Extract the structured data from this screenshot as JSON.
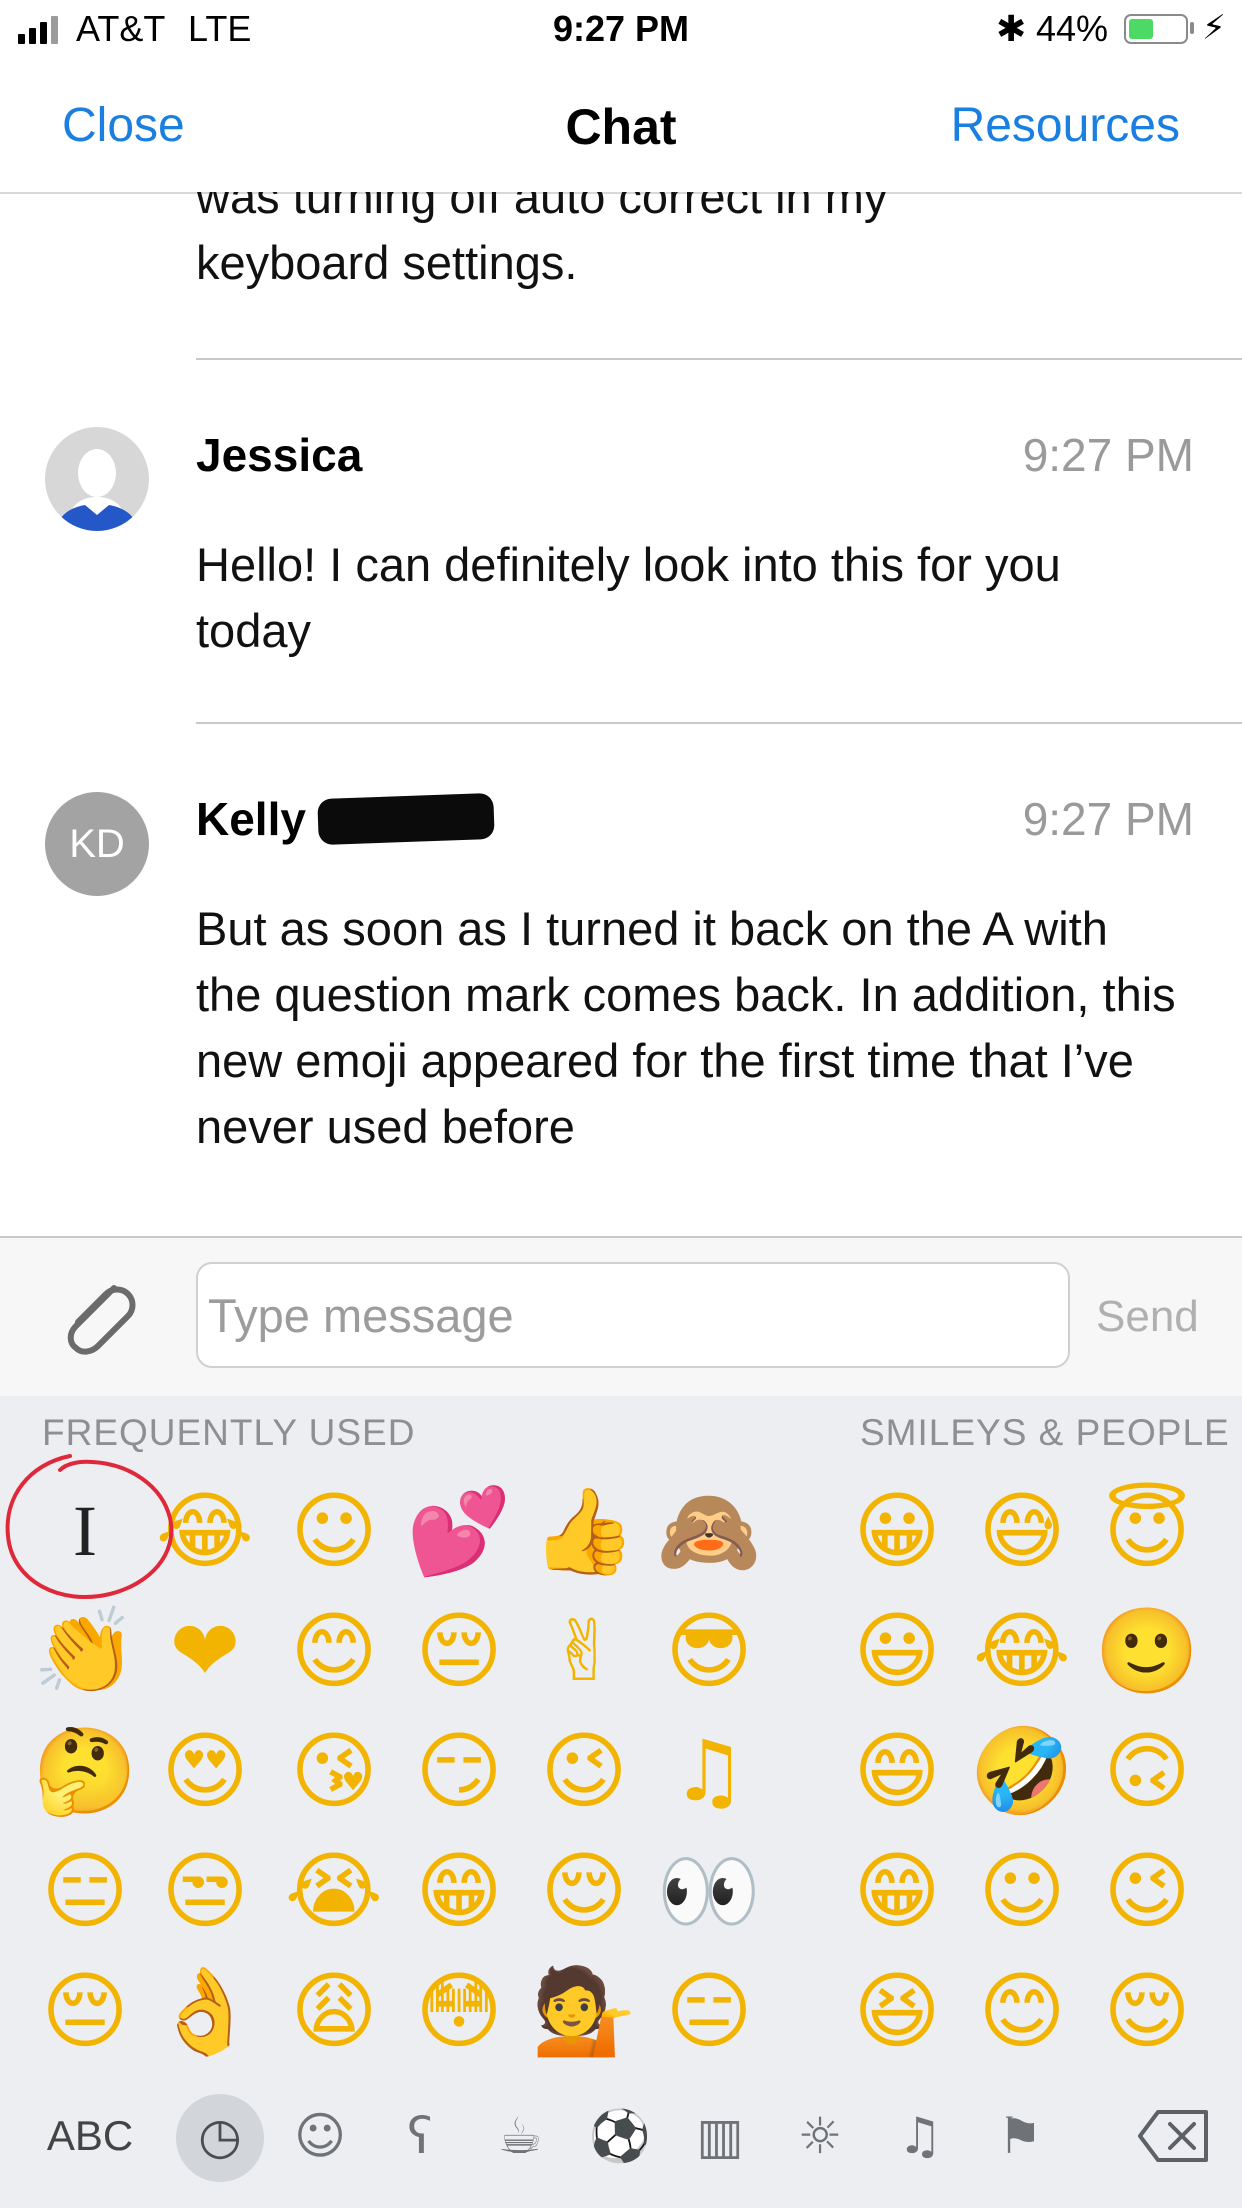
{
  "status_bar": {
    "carrier": "AT&T",
    "network": "LTE",
    "time": "9:27 PM",
    "battery": "44%",
    "battery_level": 0.44
  },
  "nav": {
    "close": "Close",
    "title": "Chat",
    "resources": "Resources"
  },
  "messages": [
    {
      "text_line1": "was turning off auto correct in my",
      "text_line2": "keyboard settings."
    },
    {
      "sender": "Jessica",
      "time": "9:27 PM",
      "text": "Hello! I can definitely look into this for you today"
    },
    {
      "sender": "Kelly",
      "initials": "KD",
      "time": "9:27 PM",
      "text": "But as soon as I turned it back on the A with the question mark comes back. In addition, this new emoji appeared for the first time that I’ve never used before"
    }
  ],
  "composer": {
    "placeholder": "Type message",
    "send": "Send"
  },
  "keyboard": {
    "section_frequent": "FREQUENTLY USED",
    "section_smileys": "SMILEYS & PEOPLE",
    "abc": "ABC",
    "frequent_rows": [
      [
        "I",
        "😂",
        "☺",
        "💕",
        "👍",
        "🙈"
      ],
      [
        "👏",
        "❤",
        "😊",
        "😔",
        "✌",
        "😎"
      ],
      [
        "🤔",
        "😍",
        "😘",
        "😏",
        "😉",
        "♫"
      ],
      [
        "😑",
        "😒",
        "😭",
        "😁",
        "😌",
        "👀"
      ],
      [
        "😔",
        "👌",
        "😩",
        "😳",
        "💁",
        "😑"
      ]
    ],
    "smiley_rows": [
      [
        "😀",
        "😅",
        "😇"
      ],
      [
        "😃",
        "😂",
        "🙂"
      ],
      [
        "😄",
        "🤣",
        "🙃"
      ],
      [
        "😁",
        "☺",
        "😉"
      ],
      [
        "😆",
        "😊",
        "😌"
      ]
    ],
    "category_icons": [
      "clock-icon",
      "smiley-icon",
      "bear-icon",
      "food-icon",
      "ball-icon",
      "building-icon",
      "bulb-icon",
      "symbols-icon",
      "flag-icon"
    ],
    "accent": "#1a7fe0"
  }
}
